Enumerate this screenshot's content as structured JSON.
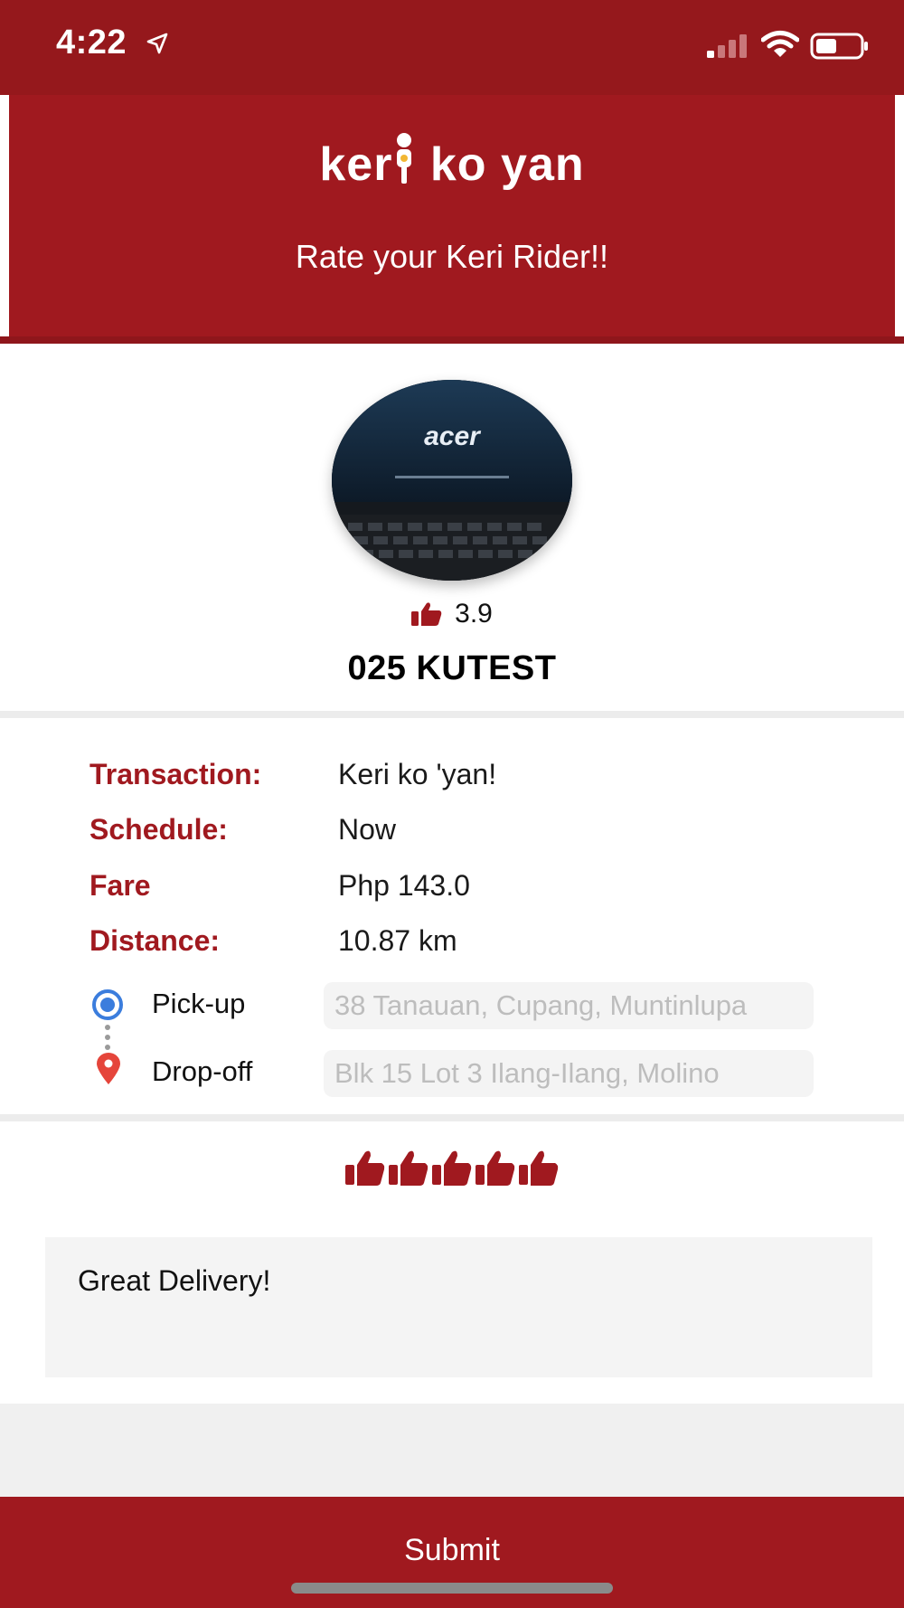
{
  "status_bar": {
    "time": "4:22"
  },
  "header": {
    "logo_left": "ker",
    "logo_right": "ko yan",
    "title": "Rate your Keri Rider!!"
  },
  "rider": {
    "rating": "3.9",
    "name": "025 KUTEST",
    "avatar_text": "acer"
  },
  "details": {
    "transaction_label": "Transaction:",
    "transaction_value": "Keri ko 'yan!",
    "schedule_label": "Schedule:",
    "schedule_value": "Now",
    "fare_label": "Fare",
    "fare_value": "Php 143.0",
    "distance_label": "Distance:",
    "distance_value": "10.87 km"
  },
  "route": {
    "pickup_label": "Pick-up",
    "pickup_value": "38 Tanauan, Cupang, Muntinlupa",
    "dropoff_label": "Drop-off",
    "dropoff_value": "Blk 15 Lot 3 Ilang-Ilang, Molino"
  },
  "feedback": {
    "thumbs_given": 5,
    "thumbs_total": 5,
    "comment": "Great Delivery!"
  },
  "actions": {
    "submit_label": "Submit"
  },
  "colors": {
    "brand": "#a0191f",
    "status_bar": "#95181c",
    "pickup_blue": "#3b7ddd",
    "dropoff_red": "#e5453b"
  }
}
